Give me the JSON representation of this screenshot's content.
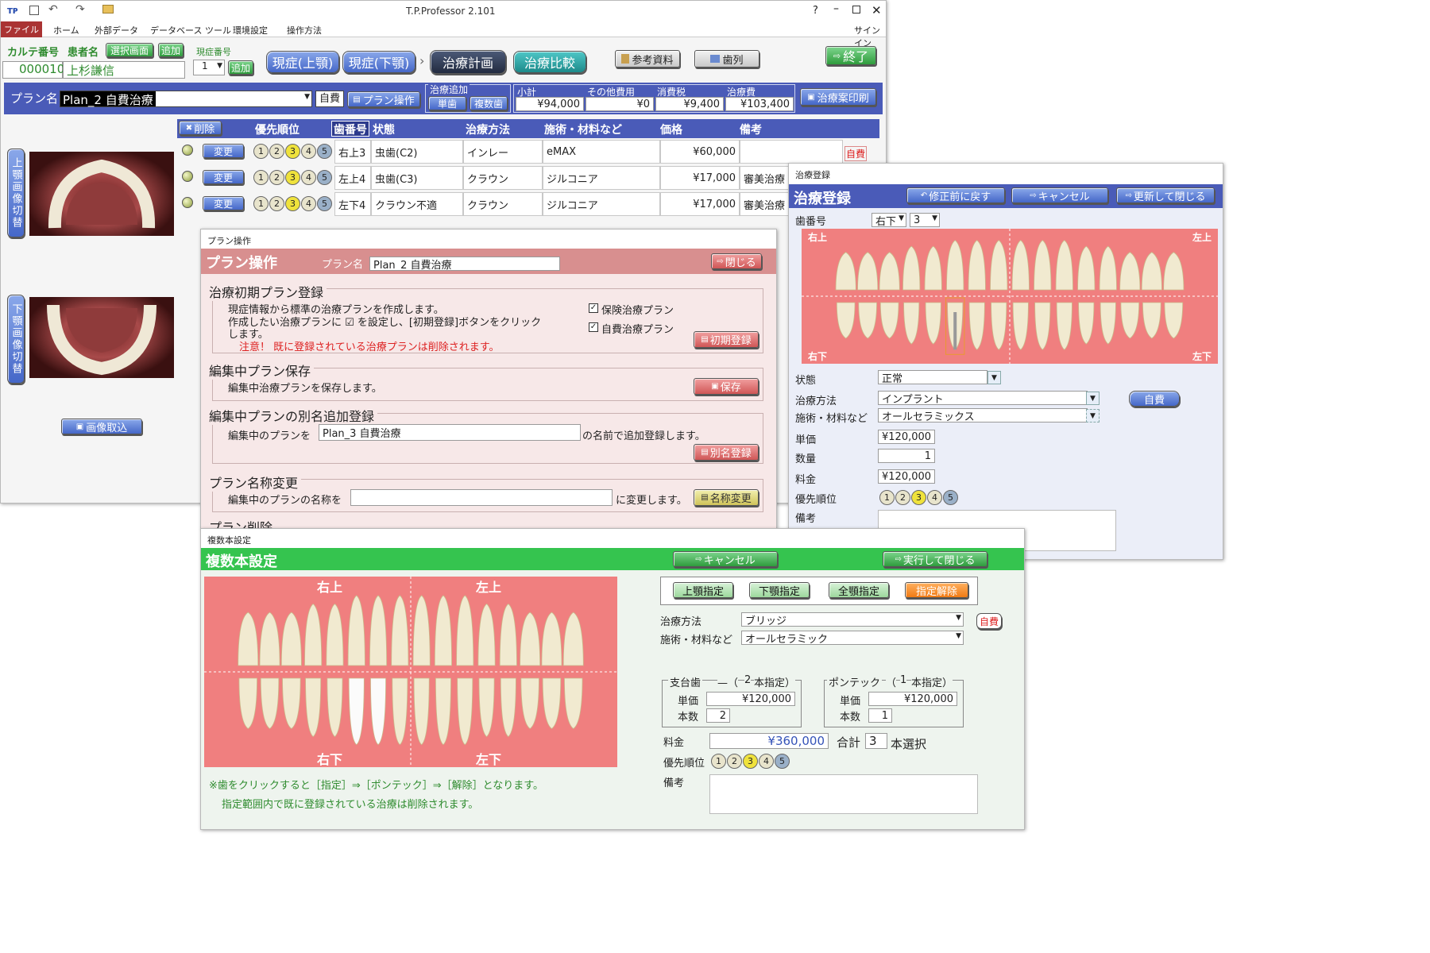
{
  "app": {
    "title": "T.P.Professor 2.101",
    "help": "?",
    "signin": "サインイン"
  },
  "ribbon": {
    "tabs": [
      "ファイル",
      "ホーム",
      "外部データ",
      "データベース ツール",
      "環境設定",
      "操作方法"
    ]
  },
  "header": {
    "karte_label": "カルテ番号",
    "patient_label": "患者名",
    "select_screen": "選択画面",
    "add": "追加",
    "genshou_label": "現症番号",
    "genshou_value": "1",
    "genshou_add": "追加",
    "karte_no": "000010",
    "patient_name": "上杉謙信",
    "btn_upper": "現症(上顎)",
    "btn_lower": "現症(下顎)",
    "btn_plan": "治療計画",
    "btn_compare": "治療比較",
    "btn_ref": "参考資料",
    "btn_teeth": "歯列",
    "btn_exit": "終了"
  },
  "planbar": {
    "label": "プラン名",
    "plan_name": "Plan_2 自費治療",
    "tag": "自費",
    "op": "プラン操作",
    "add_group": "治療追加",
    "single": "単歯",
    "multi": "複数歯",
    "sum_headers": [
      "小計",
      "その他費用",
      "消費税",
      "治療費"
    ],
    "sums": [
      "¥94,000",
      "¥0",
      "¥9,400",
      "¥103,400"
    ],
    "print": "治療案印刷"
  },
  "table": {
    "delete": "削除",
    "headers": [
      "優先順位",
      "歯番号",
      "状態",
      "治療方法",
      "施術・材料など",
      "価格",
      "備考"
    ],
    "change": "変更",
    "rows": [
      {
        "tooth": "右上3",
        "state": "虫歯(C2)",
        "method": "インレー",
        "material": "eMAX",
        "price": "¥60,000",
        "note": "",
        "badge": "自費"
      },
      {
        "tooth": "左上4",
        "state": "虫歯(C3)",
        "method": "クラウン",
        "material": "ジルコニア",
        "price": "¥17,000",
        "note": "審美治療",
        "badge": ""
      },
      {
        "tooth": "左下4",
        "state": "クラウン不適",
        "method": "クラウン",
        "material": "ジルコニア",
        "price": "¥17,000",
        "note": "審美治療",
        "badge": ""
      }
    ]
  },
  "side": {
    "upper_switch": "上顎画像切替",
    "lower_switch": "下顎画像切替",
    "capture": "画像取込"
  },
  "plan_ops": {
    "window_title": "プラン操作",
    "heading": "プラン操作",
    "plan_label": "プラン名",
    "plan_name": "Plan_2 自費治療",
    "close": "閉じる",
    "s1": {
      "title": "治療初期プラン登録",
      "line1": "現症情報から標準の治療プランを作成します。",
      "line2": "作成したい治療プランに ☑ を設定し、[初期登録]ボタンをクリック",
      "line3": "します。",
      "warn": "注意！ 既に登録されている治療プランは削除されます。",
      "cb1": "保険治療プラン",
      "cb2": "自費治療プラン",
      "btn": "初期登録"
    },
    "s2": {
      "title": "編集中プラン保存",
      "line": "編集中治療プランを保存します。",
      "btn": "保存"
    },
    "s3": {
      "title": "編集中プランの別名追加登録",
      "pre": "編集中のプランを",
      "value": "Plan_3 自費治療",
      "post": "の名前で追加登録します。",
      "btn": "別名登録"
    },
    "s4": {
      "title": "プラン名称変更",
      "pre": "編集中のプランの名称を",
      "value": "",
      "post": "に変更します。",
      "btn": "名称変更"
    },
    "s5": {
      "title": "プラン削除"
    }
  },
  "treat_reg": {
    "window_title": "治療登録",
    "heading": "治療登録",
    "revert": "修正前に戻す",
    "cancel": "キャンセル",
    "update": "更新して閉じる",
    "tooth_label": "歯番号",
    "tooth_side": "右下",
    "tooth_no": "3",
    "q": {
      "ul": "右上",
      "ur": "左上",
      "ll": "右下",
      "lr": "左下"
    },
    "state_label": "状態",
    "state": "正常",
    "method_label": "治療方法",
    "method": "インプラント",
    "material_label": "施術・材料など",
    "material": "オールセラミックス",
    "self": "自費",
    "price_label": "単価",
    "price": "¥120,000",
    "qty_label": "数量",
    "qty": "1",
    "fee_label": "料金",
    "fee": "¥120,000",
    "prio_label": "優先順位",
    "note_label": "備考"
  },
  "multi": {
    "window_title": "複数本設定",
    "heading": "複数本設定",
    "cancel": "キャンセル",
    "exec": "実行して閉じる",
    "q": {
      "ul": "右上",
      "ur": "左上",
      "ll": "右下",
      "lr": "左下"
    },
    "sel_upper": "上顎指定",
    "sel_lower": "下顎指定",
    "sel_all": "全顎指定",
    "sel_clear": "指定解除",
    "method_label": "治療方法",
    "method": "ブリッジ",
    "material_label": "施術・材料など",
    "material": "オールセラミック",
    "self": "自費",
    "abut_title": "支台歯",
    "abut_count_pre": "—（",
    "abut_count": "2",
    "abut_count_post": "本指定）",
    "pontic_title": "ポンテック",
    "pontic_count_pre": "（",
    "pontic_count": "1",
    "pontic_count_post": "本指定）",
    "unit_label": "単価",
    "count_label": "本数",
    "abut_price": "¥120,000",
    "abut_qty": "2",
    "pontic_price": "¥120,000",
    "pontic_qty": "1",
    "fee_label": "料金",
    "fee": "¥360,000",
    "total_label": "合計",
    "total": "3",
    "total_post": "本選択",
    "prio_label": "優先順位",
    "note_label": "備考",
    "hint1": "※歯をクリックすると［指定］⇒［ポンテック］⇒［解除］となります。",
    "hint2": "指定範囲内で既に登録されている治療は削除されます。"
  },
  "colors": {
    "accent": "#4a5bb8",
    "plan_band": "#d88f8f",
    "multi_band": "#35c44f",
    "teeth_bg": "#f07f7f"
  }
}
